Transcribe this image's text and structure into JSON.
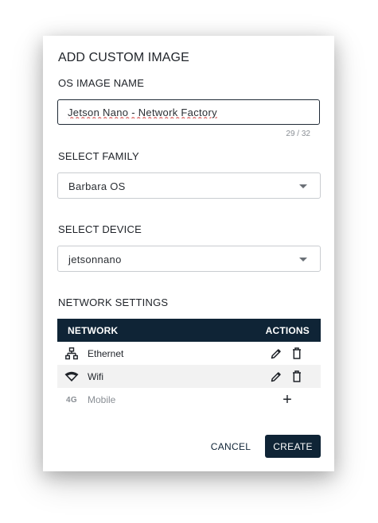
{
  "dialog": {
    "title": "ADD CUSTOM IMAGE",
    "os_image_name": {
      "label": "OS IMAGE NAME",
      "value": "Jetson Nano - Network Factory",
      "counter": "29 / 32"
    },
    "family": {
      "label": "SELECT FAMILY",
      "value": "Barbara OS"
    },
    "device": {
      "label": "SELECT DEVICE",
      "value": "jetsonnano"
    },
    "network_settings": {
      "label": "NETWORK SETTINGS",
      "columns": [
        "NETWORK",
        "ACTIONS"
      ],
      "rows": [
        {
          "name": "Ethernet",
          "icon": "ethernet-icon",
          "actions": [
            "edit-icon",
            "delete-icon"
          ]
        },
        {
          "name": "Wifi",
          "icon": "wifi-icon",
          "actions": [
            "edit-icon",
            "delete-icon"
          ]
        },
        {
          "name": "Mobile",
          "icon": "4g-icon",
          "icon_text": "4G",
          "actions": [
            "add-icon"
          ]
        }
      ]
    },
    "buttons": {
      "cancel": "CANCEL",
      "create": "CREATE"
    }
  },
  "colors": {
    "primary": "#0f2436",
    "row_alt": "#f2f2f2",
    "muted": "#8a8f95"
  }
}
